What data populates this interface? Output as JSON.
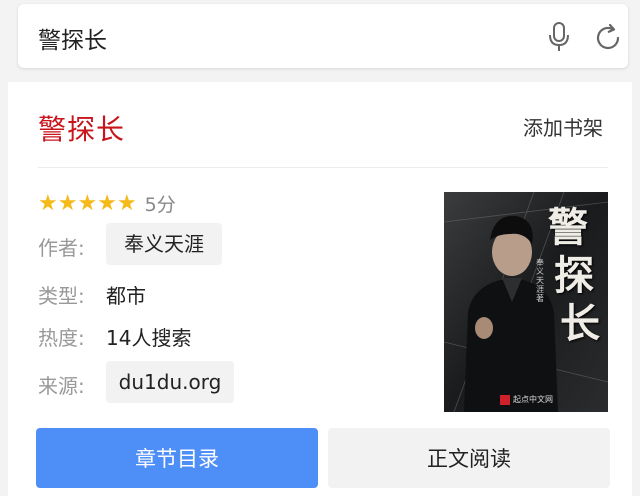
{
  "search": {
    "query": "警探长"
  },
  "book": {
    "title": "警探长",
    "add_shelf_label": "添加书架",
    "rating_stars": 5,
    "rating_text": "5分",
    "author_label": "作者:",
    "author": "奉义天涯",
    "type_label": "类型:",
    "type": "都市",
    "heat_label": "热度:",
    "heat": "14人搜索",
    "source_label": "来源:",
    "source": "du1du.org",
    "cover": {
      "title_chars": [
        "警",
        "探",
        "长"
      ],
      "author_text": "奉义天涯 著",
      "publisher": "起点中文网"
    }
  },
  "actions": {
    "chapters_label": "章节目录",
    "read_label": "正文阅读"
  },
  "colors": {
    "title_red": "#c8151b",
    "star_gold": "#f5b919",
    "primary_blue": "#4e8ef7"
  }
}
